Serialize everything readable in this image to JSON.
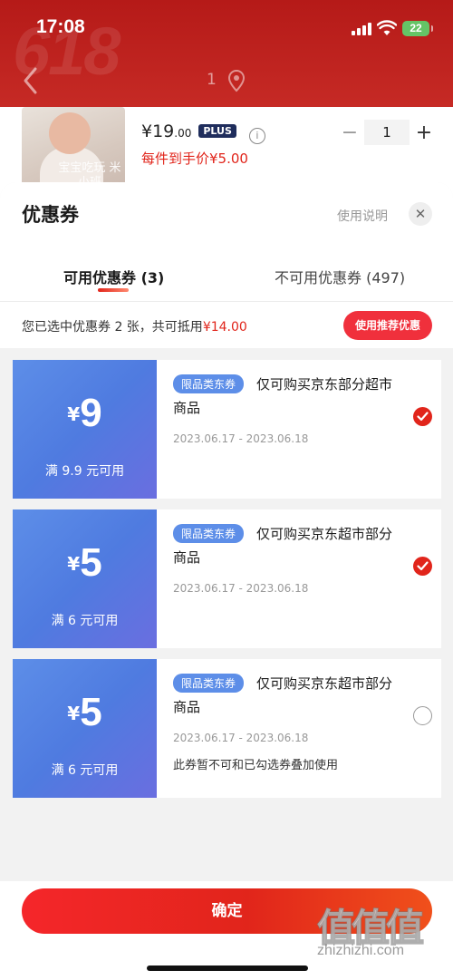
{
  "status_bar": {
    "time": "17:08",
    "battery": "22"
  },
  "background_page": {
    "banner_text": "618",
    "page_count": "1",
    "product": {
      "image_text": "宝宝吃玩 米小班",
      "price_main": "¥19",
      "price_decimal": ".00",
      "plus_label": "PLUS",
      "unit_price": "每件到手价¥5.00",
      "quantity": "1"
    }
  },
  "sheet": {
    "title": "优惠券",
    "help_link": "使用说明",
    "tabs": [
      {
        "label": "可用优惠券 (3)"
      },
      {
        "label": "不可用优惠券 (497)"
      }
    ],
    "summary_prefix": "您已选中优惠券 2 张，共可抵用",
    "summary_amount": "¥14.00",
    "recommend_button": "使用推荐优惠",
    "coupons": [
      {
        "yen": "¥",
        "amount": "9",
        "condition": "满 9.9 元可用",
        "tag": "限品类东券",
        "desc": "仅可购买京东部分超市商品",
        "date": "2023.06.17 - 2023.06.18",
        "note": "",
        "selected": true
      },
      {
        "yen": "¥",
        "amount": "5",
        "condition": "满 6 元可用",
        "tag": "限品类东券",
        "desc": "仅可购买京东超市部分商品",
        "date": "2023.06.17 - 2023.06.18",
        "note": "",
        "selected": true
      },
      {
        "yen": "¥",
        "amount": "5",
        "condition": "满 6 元可用",
        "tag": "限品类东券",
        "desc": "仅可购买京东超市部分商品",
        "date": "2023.06.17 - 2023.06.18",
        "note": "此券暂不可和已勾选券叠加使用",
        "selected": false
      }
    ],
    "confirm_button": "确定"
  },
  "watermark": {
    "glyphs": "值值值",
    "url": "zhizhizhi.com"
  }
}
